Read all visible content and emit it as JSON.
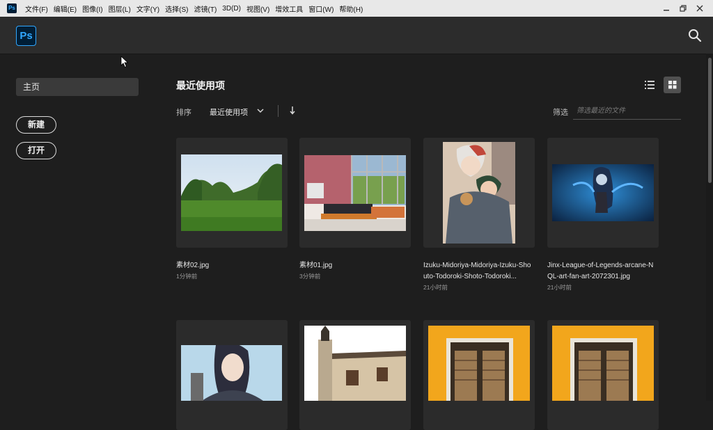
{
  "menubar": {
    "app_icon_text": "Ps",
    "items": [
      "文件(F)",
      "编辑(E)",
      "图像(I)",
      "图层(L)",
      "文字(Y)",
      "选择(S)",
      "滤镜(T)",
      "3D(D)",
      "视图(V)",
      "增效工具",
      "窗口(W)",
      "帮助(H)"
    ]
  },
  "header": {
    "logo_text": "Ps"
  },
  "sidebar": {
    "home_label": "主页",
    "new_label": "新建",
    "open_label": "打开"
  },
  "main": {
    "title": "最近使用项",
    "sort_label": "排序",
    "sort_value": "最近使用项",
    "filter_label": "筛选",
    "filter_placeholder": "筛选最近的文件"
  },
  "files": [
    {
      "name": "素材02.jpg",
      "time": "1分钟前"
    },
    {
      "name": "素材01.jpg",
      "time": "3分钟前"
    },
    {
      "name": "Izuku-Midoriya-Midoriya-Izuku-Shouto-Todoroki-Shoto-Todoroki...",
      "time": "21小时前"
    },
    {
      "name": "Jinx-League-of-Legends-arcane-NQL-art-fan-art-2072301.jpg",
      "time": "21小时前"
    }
  ],
  "colors": {
    "accent": "#31a8ff",
    "ps_bg": "#001e36",
    "bg": "#1e1e1e",
    "header_bg": "#2c2c2c"
  }
}
